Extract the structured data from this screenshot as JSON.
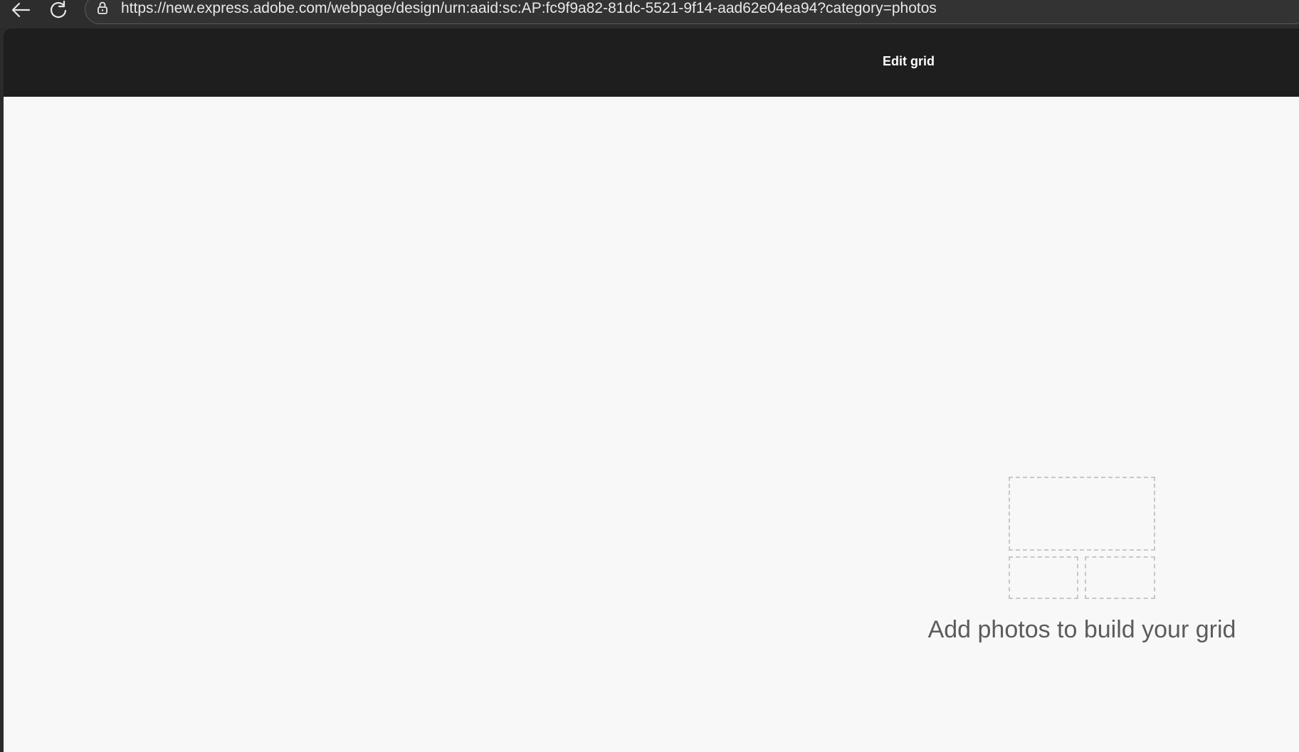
{
  "browser": {
    "url": "https://new.express.adobe.com/webpage/design/urn:aaid:sc:AP:fc9f9a82-81dc-5521-9f14-aad62e04ea94?category=photos",
    "back_icon": "arrow-left-icon",
    "reload_icon": "reload-icon",
    "lock_icon": "lock-icon"
  },
  "header": {
    "title": "Edit grid"
  },
  "canvas": {
    "empty_message": "Add photos to build your grid",
    "placeholder_icon": "photo-grid-placeholder-icon"
  },
  "colors": {
    "header_bg": "#1e1e1e",
    "canvas_bg": "#f8f8f8",
    "placeholder_border": "#c8c8c8",
    "message_text": "#5c5c5c"
  }
}
